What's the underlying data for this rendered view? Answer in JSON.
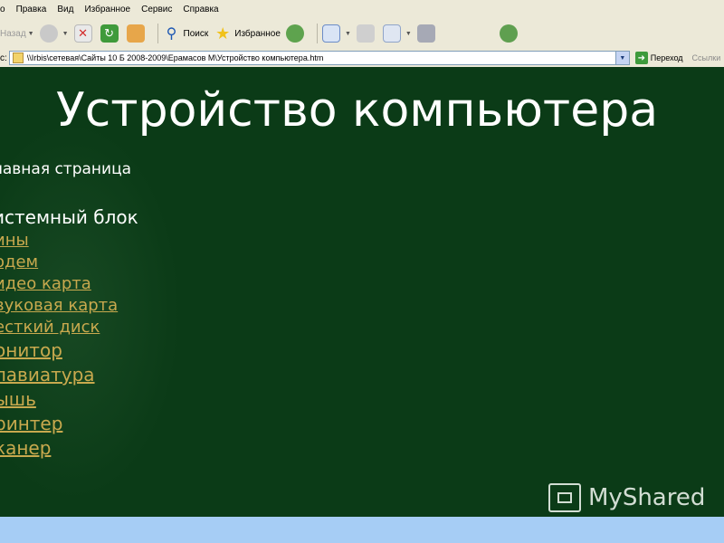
{
  "menu": [
    "о",
    "Правка",
    "Вид",
    "Избранное",
    "Сервис",
    "Справка"
  ],
  "toolbar": {
    "back_label": "Назад",
    "search_label": "Поиск",
    "favorites_label": "Избранное"
  },
  "address": {
    "label": "с:",
    "url": "\\\\Irbis\\сетевая\\Сайты 10 Б 2008-2009\\Ерамасов М\\Устройство компьютера.htm",
    "go_label": "Переход",
    "links_label": "Ссылки"
  },
  "page": {
    "title": "Устройство компьютера",
    "home": "лавная страница",
    "section": "истемный блок",
    "links": [
      {
        "label": "ины"
      },
      {
        "label": "одем"
      },
      {
        "label": "идео карта"
      },
      {
        "label": "вуковая карта"
      },
      {
        "label": "есткий диск"
      },
      {
        "label": "онитор"
      },
      {
        "label": "лавиатура"
      },
      {
        "label": "ышь"
      },
      {
        "label": "ринтер"
      },
      {
        "label": "канер"
      }
    ]
  },
  "watermark": "MyShared",
  "colors": {
    "page_background": "#0b3b17",
    "link": "#c8a94e",
    "chrome": "#ece9d8",
    "taskbar": "#a6cdf5"
  }
}
